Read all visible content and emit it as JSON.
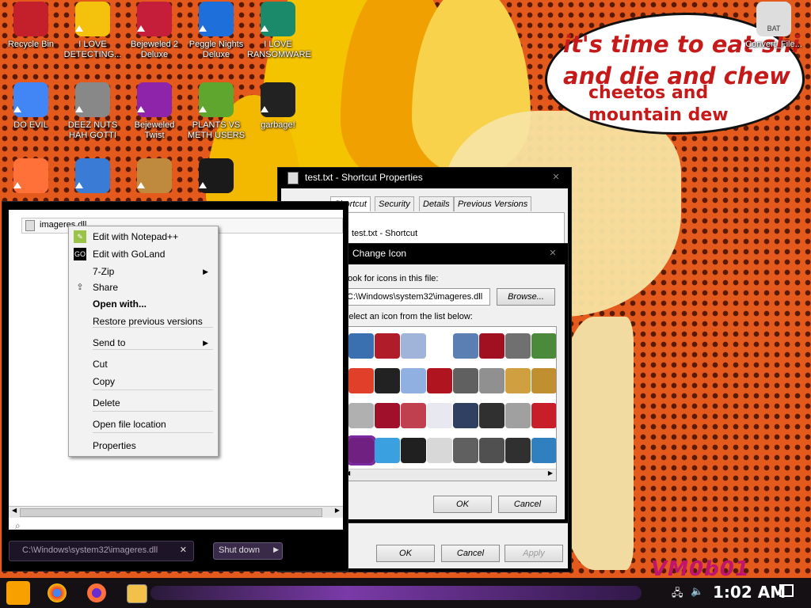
{
  "desktop": {
    "icons": [
      {
        "label": "Recycle Bin",
        "icon": "recycle-bin-icon",
        "color": "#c4202c"
      },
      {
        "label": "I LOVE DETECTING...",
        "icon": "de-app-icon",
        "color": "#f4c20d"
      },
      {
        "label": "Bejeweled 2 Deluxe",
        "icon": "bejeweled-icon",
        "color": "#c41e3a"
      },
      {
        "label": "Peggle Nights Deluxe",
        "icon": "peggle-icon",
        "color": "#1e6fd9"
      },
      {
        "label": "I LOVE RANSOMWARE",
        "icon": "publisher-icon",
        "color": "#1a8a6a"
      },
      {
        "label": "DO EVIL",
        "icon": "chrome-icon",
        "color": "#4285f4"
      },
      {
        "label": "DEEZ NUTS HAH GOTTI",
        "icon": "windows-stack-icon",
        "color": "#888888"
      },
      {
        "label": "Bejeweled Twist",
        "icon": "gem-icon",
        "color": "#8e24aa"
      },
      {
        "label": "PLANTS VS METH USERS",
        "icon": "plant-icon",
        "color": "#5fa62e"
      },
      {
        "label": "garbage!",
        "icon": "splat-icon",
        "color": "#222222"
      },
      {
        "label": "",
        "icon": "firefox-icon",
        "color": "#ff7139"
      },
      {
        "label": "",
        "icon": "network-search-icon",
        "color": "#3a7bd5"
      },
      {
        "label": "",
        "icon": "money-bag-icon",
        "color": "#c08a3e"
      },
      {
        "label": "",
        "icon": "green-ball-icon",
        "color": "#1a1a1a"
      },
      {
        "label": "Convert_File...",
        "icon": "bat-file-icon",
        "color": "#dddddd",
        "badge": "BAT"
      }
    ],
    "bubble_lines": [
      "it's time to eat shi",
      "and die and chew",
      "cheetos and",
      "mountain dew"
    ],
    "watermark": "VM0b01"
  },
  "properties_window": {
    "title": "test.txt - Shortcut Properties",
    "tabs": [
      "Shortcut",
      "Security",
      "Details",
      "Previous Versions"
    ],
    "target_name": "test.txt - Shortcut",
    "buttons": {
      "ok": "OK",
      "cancel": "Cancel",
      "apply": "Apply"
    }
  },
  "change_icon_dialog": {
    "title": "Change Icon",
    "look_label": "Look for icons in this file:",
    "path_value": "C:\\Windows\\system32\\imageres.dll",
    "browse": "Browse...",
    "select_label": "Select an icon from the list below:",
    "ok": "OK",
    "cancel": "Cancel",
    "icon_colors": [
      "#3a6fb0",
      "#b01c2a",
      "#9fb4d8",
      "#ffffff",
      "#5b7fb3",
      "#a01020",
      "#707070",
      "#4a8a3a",
      "#e0402a",
      "#222222",
      "#8fb0e0",
      "#b0141e",
      "#606060",
      "#909090",
      "#d0a040",
      "#c09030",
      "#b0b0b0",
      "#a0102a",
      "#c04050",
      "#e8e8f0",
      "#304060",
      "#303030",
      "#a0a0a0",
      "#c81e2a",
      "#702080",
      "#3aa0e0",
      "#202020",
      "#d8d8d8",
      "#606060",
      "#505050",
      "#303030",
      "#3080c0"
    ]
  },
  "explorer_window": {
    "file_item": "imageres.dll",
    "search_value": "C:\\Windows\\system32\\imageres.dll",
    "shutdown": "Shut down"
  },
  "context_menu": {
    "items": [
      {
        "label": "Edit with Notepad++",
        "icon": "notepadpp-icon",
        "bold": false,
        "submenu": false
      },
      {
        "label": "Edit with GoLand",
        "icon": "goland-icon",
        "bold": false,
        "submenu": false
      },
      {
        "label": "7-Zip",
        "icon": "",
        "bold": false,
        "submenu": true
      },
      {
        "label": "Share",
        "icon": "share-icon",
        "bold": false,
        "submenu": false
      },
      {
        "label": "Open with...",
        "icon": "",
        "bold": true,
        "submenu": false
      },
      {
        "label": "Restore previous versions",
        "icon": "",
        "bold": false,
        "submenu": false
      },
      {
        "label": "Send to",
        "icon": "",
        "bold": false,
        "submenu": true
      },
      {
        "label": "Cut",
        "icon": "",
        "bold": false,
        "submenu": false
      },
      {
        "label": "Copy",
        "icon": "",
        "bold": false,
        "submenu": false
      },
      {
        "label": "Delete",
        "icon": "",
        "bold": false,
        "submenu": false
      },
      {
        "label": "Open file location",
        "icon": "",
        "bold": false,
        "submenu": false
      },
      {
        "label": "Properties",
        "icon": "",
        "bold": false,
        "submenu": false
      }
    ]
  },
  "taskbar": {
    "clock": "1:02 AM",
    "apps": [
      "start-icon",
      "chrome-icon",
      "firefox-icon",
      "file-explorer-icon"
    ]
  }
}
